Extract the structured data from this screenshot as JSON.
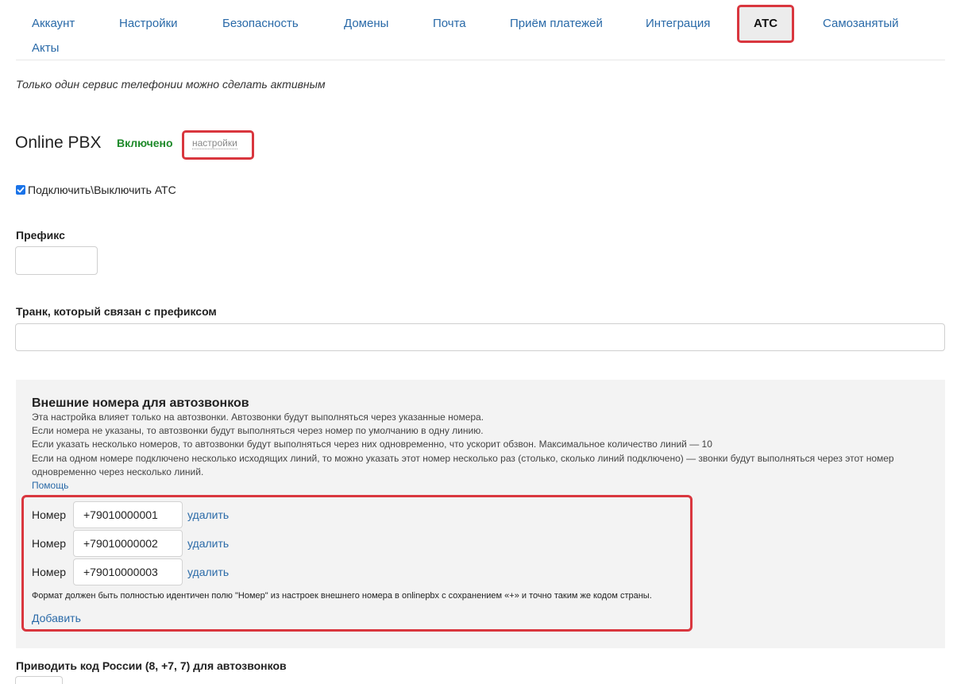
{
  "tabs": [
    {
      "label": "Аккаунт"
    },
    {
      "label": "Настройки"
    },
    {
      "label": "Безопасность"
    },
    {
      "label": "Домены"
    },
    {
      "label": "Почта"
    },
    {
      "label": "Приём платежей"
    },
    {
      "label": "Интеграция"
    },
    {
      "label": "АТС",
      "active": true
    },
    {
      "label": "Самозанятый"
    },
    {
      "label": "Акты"
    }
  ],
  "note": "Только один сервис телефонии можно сделать активным",
  "service": {
    "title": "Online PBX",
    "status": "Включено",
    "settings_link": "настройки"
  },
  "toggle": {
    "checked": true,
    "label": "Подключить\\Выключить АТС"
  },
  "prefix": {
    "label": "Префикс",
    "value": ""
  },
  "trunk": {
    "label": "Транк, который связан с префиксом",
    "value": ""
  },
  "external_numbers": {
    "title": "Внешние номера для автозвонков",
    "description": [
      "Эта настройка влияет только на автозвонки. Автозвонки будут выполняться через указанные номера.",
      "Если номера не указаны, то автозвонки будут выполняться через номер по умолчанию в одну линию.",
      "Если указать несколько номеров, то автозвонки будут выполняться через них одновременно, что ускорит обзвон. Максимальное количество линий — 10",
      "Если на одном номере подключено несколько исходящих линий, то можно указать этот номер несколько раз (столько, сколько линий подключено) — звонки будут выполняться через этот номер одновременно через несколько линий."
    ],
    "help_link": "Помощь",
    "number_label": "Номер",
    "delete_label": "удалить",
    "numbers": [
      "+79010000001",
      "+79010000002",
      "+79010000003"
    ],
    "format_note": "Формат должен быть полностью идентичен полю \"Номер\" из настроек внешнего номера в onlinepbx с сохранением «+» и точно таким же кодом страны.",
    "add_link": "Добавить"
  },
  "russia_code": {
    "label": "Приводить код России (8, +7, 7) для автозвонков"
  },
  "colors": {
    "link": "#2a6aa8",
    "status_on": "#1e8a2a",
    "highlight": "#d9363e",
    "panel_bg": "#f3f3f3"
  }
}
